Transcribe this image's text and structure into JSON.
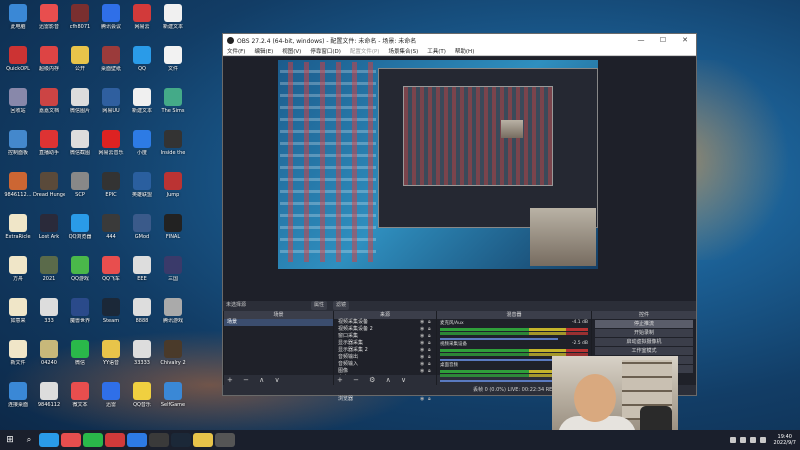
{
  "desktop": {
    "icons": [
      {
        "label": "此电脑",
        "color": "#3a88d6"
      },
      {
        "label": "迅雷影音",
        "color": "#e84e4e"
      },
      {
        "label": "cfh8071",
        "color": "#7a2f2f"
      },
      {
        "label": "腾讯会议",
        "color": "#2f6fe8"
      },
      {
        "label": "网易云",
        "color": "#d23a3a"
      },
      {
        "label": "新建文本",
        "color": "#f0f0f0"
      },
      {
        "label": "QuickOPL",
        "color": "#c33"
      },
      {
        "label": "超级内存",
        "color": "#d44"
      },
      {
        "label": "公开",
        "color": "#e8c44a"
      },
      {
        "label": "桌面壁纸",
        "color": "#9b3b3b"
      },
      {
        "label": "QQ",
        "color": "#2a9be8"
      },
      {
        "label": "文件",
        "color": "#f2f2f2"
      },
      {
        "label": "回收站",
        "color": "#88a"
      },
      {
        "label": "嘉嘉文档",
        "color": "#c44"
      },
      {
        "label": "微信图片",
        "color": "#ddd"
      },
      {
        "label": "网易UU",
        "color": "#2f5f9f"
      },
      {
        "label": "新建文本",
        "color": "#f0f0f0"
      },
      {
        "label": "The Sims",
        "color": "#4a8"
      },
      {
        "label": "控制面板",
        "color": "#4488cc"
      },
      {
        "label": "直播助手",
        "color": "#d33"
      },
      {
        "label": "微信截图",
        "color": "#ddd"
      },
      {
        "label": "网易云音乐",
        "color": "#d22"
      },
      {
        "label": "小度",
        "color": "#2d7be5"
      },
      {
        "label": "Inside the",
        "color": "#333"
      },
      {
        "label": "9846112…",
        "color": "#c63"
      },
      {
        "label": "Dread Hunger",
        "color": "#5a4a3a"
      },
      {
        "label": "SCP",
        "color": "#888"
      },
      {
        "label": "EPIC",
        "color": "#333"
      },
      {
        "label": "英雄联盟",
        "color": "#2a5f9f"
      },
      {
        "label": "Jump",
        "color": "#b33"
      },
      {
        "label": "ExtraRicle",
        "color": "#f0e6c8"
      },
      {
        "label": "Lost Ark",
        "color": "#2a2a3a"
      },
      {
        "label": "QQ浏览器",
        "color": "#2a9be8"
      },
      {
        "label": "444",
        "color": "#3a3a3a"
      },
      {
        "label": "GMod",
        "color": "#3a5a8a"
      },
      {
        "label": "FINAL",
        "color": "#222"
      },
      {
        "label": "方舟",
        "color": "#f0e6c8"
      },
      {
        "label": "2021",
        "color": "#5a6a4a"
      },
      {
        "label": "QQ游戏",
        "color": "#4ab84a"
      },
      {
        "label": "QQ飞车",
        "color": "#e84e4e"
      },
      {
        "label": "EEE",
        "color": "#ddd"
      },
      {
        "label": "三国",
        "color": "#3a3a6a"
      },
      {
        "label": "如意来",
        "color": "#f0e6c8"
      },
      {
        "label": "333",
        "color": "#ddd"
      },
      {
        "label": "魔兽世界",
        "color": "#2a4a8a"
      },
      {
        "label": "Steam",
        "color": "#1b2838"
      },
      {
        "label": "8888",
        "color": "#ddd"
      },
      {
        "label": "腾讯游戏",
        "color": "#aaa"
      },
      {
        "label": "新文件",
        "color": "#f0e6c8"
      },
      {
        "label": "04240",
        "color": "#c8b87a"
      },
      {
        "label": "微信",
        "color": "#2ab84a"
      },
      {
        "label": "YY语音",
        "color": "#e8c44a"
      },
      {
        "label": "33333",
        "color": "#ddd"
      },
      {
        "label": "Chivalry 2",
        "color": "#4a3a2a"
      },
      {
        "label": "连接桌面",
        "color": "#3a88d6"
      },
      {
        "label": "9846112",
        "color": "#ddd"
      },
      {
        "label": "微文本",
        "color": "#e84e4e"
      },
      {
        "label": "迅雷",
        "color": "#2f6fe8"
      },
      {
        "label": "QQ音乐",
        "color": "#f0d040"
      },
      {
        "label": "SelfGame",
        "color": "#3a88d6"
      }
    ]
  },
  "obs": {
    "title": "OBS 27.2.4 (64-bit, windows) - 配置文件: 未命名 - 场景: 未命名",
    "menu": [
      "文件(F)",
      "编辑(E)",
      "视图(V)",
      "停靠窗口(D)",
      "配置文件(P)",
      "场景集合(S)",
      "工具(T)",
      "帮助(H)"
    ],
    "menu_dim": [
      false,
      false,
      false,
      false,
      true,
      false,
      false,
      false
    ],
    "window_controls": {
      "minimize": "—",
      "maximize": "☐",
      "close": "✕"
    },
    "source_label": "未选择源",
    "preview_toolbar": [
      "属性",
      "滤镜"
    ],
    "docks": {
      "scenes": {
        "title": "场景",
        "items": [
          "场景"
        ],
        "footer": "+ − ∧ ∨"
      },
      "sources": {
        "title": "来源",
        "items": [
          "视频采集设备",
          "视频采集设备 2",
          "窗口采集",
          "显示器采集",
          "显示器采集 2",
          "音频输出",
          "音频输入",
          "图像",
          "文本",
          "颜色源",
          "媒体源",
          "浏览器"
        ],
        "footer": "+ − ⚙ ∧ ∨"
      },
      "mixer": {
        "title": "混音器",
        "channels": [
          {
            "name": "麦克风/Aux",
            "level": "-4.1 dB"
          },
          {
            "name": "视频采集设备",
            "level": "-2.5 dB"
          },
          {
            "name": "桌面音频",
            "level": "0.0 dB"
          }
        ]
      },
      "controls": {
        "title": "控件",
        "buttons": [
          "停止推流",
          "开始录制",
          "启动虚拟摄像机",
          "工作室模式",
          "设置",
          "退出"
        ],
        "active_index": 0
      }
    },
    "status": "丢帧 0 (0.0%)  LIVE: 00:22:34  REC: 00:00:00  CPU: 24.1%, 60.00 fps"
  },
  "taskbar": {
    "start_icon": "windows-icon",
    "search_icon": "search-icon",
    "apps": [
      "#2a9be8",
      "#e84e4e",
      "#2ab84a",
      "#d23a3a",
      "#2d7be5",
      "#3a3a3a",
      "#1b2838",
      "#e8c44a",
      "#555"
    ],
    "time": "19:40",
    "date": "2022/9/7"
  }
}
